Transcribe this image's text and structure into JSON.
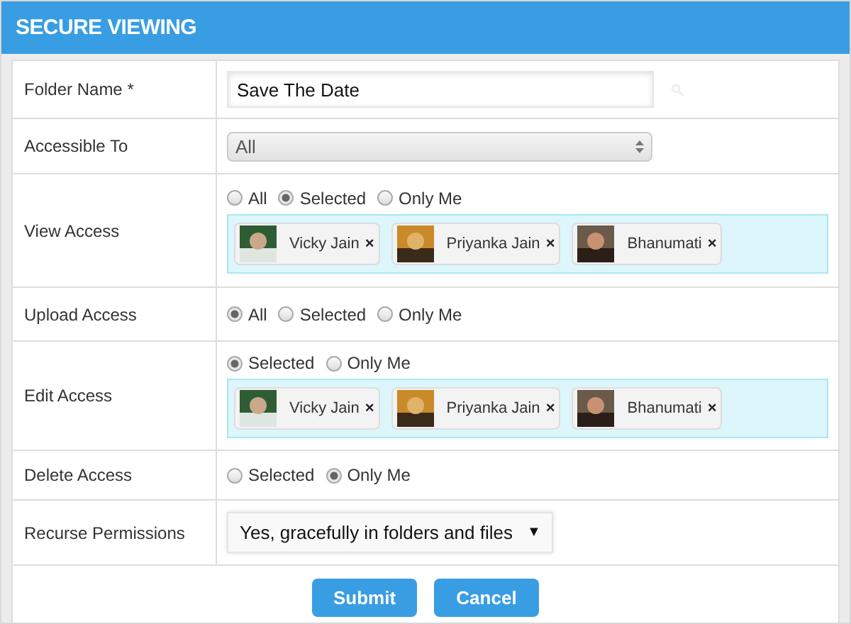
{
  "header": {
    "title": "SECURE VIEWING"
  },
  "rows": [
    {
      "kind": "text",
      "label": "Folder Name *",
      "value": "Save The Date"
    },
    {
      "kind": "select",
      "label": "Accessible To",
      "value": "All"
    },
    {
      "kind": "radios",
      "label": "View Access",
      "options": [
        {
          "label": "All",
          "selected": false
        },
        {
          "label": "Selected",
          "selected": true
        },
        {
          "label": "Only Me",
          "selected": false
        }
      ],
      "people": [
        {
          "name": "Vicky Jain",
          "remove": "×"
        },
        {
          "name": "Priyanka Jain",
          "remove": "×"
        },
        {
          "name": "Bhanumati",
          "remove": "×"
        }
      ]
    },
    {
      "kind": "radios",
      "label": "Upload Access",
      "options": [
        {
          "label": "All",
          "selected": true
        },
        {
          "label": "Selected",
          "selected": false
        },
        {
          "label": "Only Me",
          "selected": false
        }
      ]
    },
    {
      "kind": "radios",
      "label": "Edit Access",
      "options": [
        {
          "label": "Selected",
          "selected": true
        },
        {
          "label": "Only Me",
          "selected": false
        }
      ],
      "people": [
        {
          "name": "Vicky Jain",
          "remove": "×"
        },
        {
          "name": "Priyanka Jain",
          "remove": "×"
        },
        {
          "name": "Bhanumati",
          "remove": "×"
        }
      ]
    },
    {
      "kind": "radios",
      "label": "Delete Access",
      "options": [
        {
          "label": "Selected",
          "selected": false
        },
        {
          "label": "Only Me",
          "selected": true
        }
      ]
    },
    {
      "kind": "dropdown",
      "label": "Recurse Permissions",
      "value": "Yes, gracefully in folders and files",
      "caret": "▼"
    }
  ],
  "buttons": [
    {
      "label": "Submit"
    },
    {
      "label": "Cancel"
    }
  ]
}
